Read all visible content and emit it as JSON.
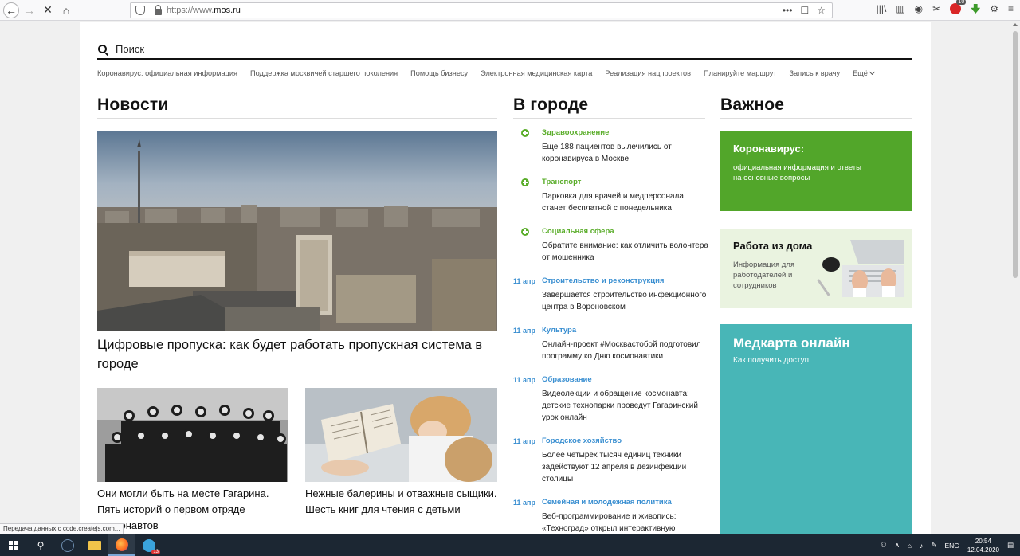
{
  "browser": {
    "url_prefix": "https://www.",
    "url_domain": "mos.ru",
    "page_actions": "•••",
    "badge_count": "10"
  },
  "search": {
    "placeholder": "Поиск"
  },
  "quicklinks": [
    "Коронавирус: официальная информация",
    "Поддержка москвичей старшего поколения",
    "Помощь бизнесу",
    "Электронная медицинская карта",
    "Реализация нацпроектов",
    "Планируйте маршрут",
    "Запись к врачу"
  ],
  "quicklinks_more": "Ещё",
  "news": {
    "title": "Новости",
    "hero_caption": "Цифровые пропуска: как будет работать пропускная система в городе",
    "item1_caption": "Они могли быть на месте Гагарина. Пять историй о первом отряде космонавтов",
    "item2_caption": "Нежные балерины и отважные сыщики. Шесть книг для чтения с детьми"
  },
  "city": {
    "title": "В городе",
    "items": [
      {
        "marker": "",
        "category": "Здравоохранение",
        "text": "Еще 188 пациентов вылечились от коронавируса в Москве",
        "color": "green"
      },
      {
        "marker": "",
        "category": "Транспорт",
        "text": "Парковка для врачей и медперсонала станет бесплатной с понедельника",
        "color": "green"
      },
      {
        "marker": "",
        "category": "Социальная сфера",
        "text": "Обратите внимание: как отличить волонтера от мошенника",
        "color": "green"
      },
      {
        "marker": "11 апр",
        "category": "Строительство и реконструкция",
        "text": "Завершается строительство инфекционного центра в Вороновском",
        "color": "blue"
      },
      {
        "marker": "11 апр",
        "category": "Культура",
        "text": "Онлайн-проект #Москвастобой подготовил программу ко Дню космонавтики",
        "color": "blue"
      },
      {
        "marker": "11 апр",
        "category": "Образование",
        "text": "Видеолекции и обращение космонавта: детские технопарки проведут Гагаринский урок онлайн",
        "color": "blue"
      },
      {
        "marker": "11 апр",
        "category": "Городское хозяйство",
        "text": "Более четырех тысяч единиц техники задействуют 12 апреля в дезинфекции столицы",
        "color": "blue"
      },
      {
        "marker": "11 апр",
        "category": "Семейная и молодежная политика",
        "text": "Веб-программирование и живопись: «Техноград» открыл интерактивную образовательную платформу",
        "color": "blue"
      }
    ]
  },
  "important": {
    "title": "Важное",
    "covid_title": "Коронавирус:",
    "covid_desc": "официальная информация и ответы на основные вопросы",
    "home_title": "Работа из дома",
    "home_desc": "Информация для работодателей и сотрудников",
    "med_title": "Медкарта онлайн",
    "med_desc": "Как получить доступ"
  },
  "status_tip": "Передача данных с code.createjs.com...",
  "taskbar": {
    "lang": "ENG",
    "time": "20:54",
    "date": "12.04.2020",
    "notification_count": "13"
  },
  "colors": {
    "green": "#52a62a",
    "teal": "#48b6b7",
    "blue_link": "#3a8fd1",
    "light_green": "#eaf3e0"
  }
}
